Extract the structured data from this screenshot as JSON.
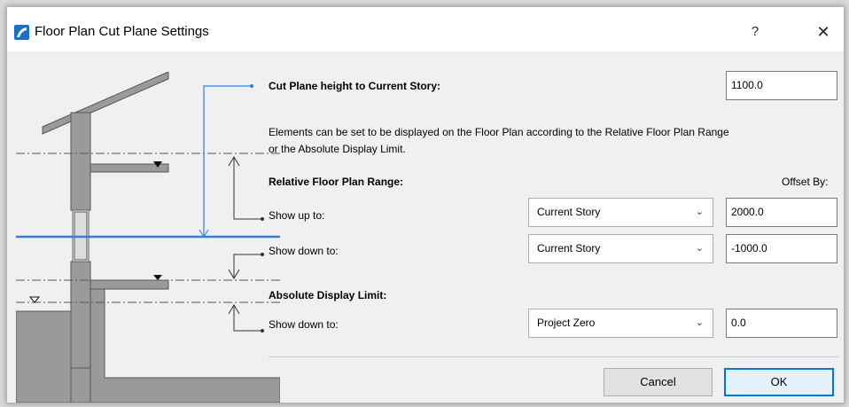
{
  "window": {
    "title": "Floor Plan Cut Plane Settings",
    "help_glyph": "?",
    "close_glyph": "✕"
  },
  "colors": {
    "cut_line": "#2f7fe0",
    "wall": "#9a9a9a",
    "ok_border": "#0078d7"
  },
  "cut_plane": {
    "label": "Cut Plane height to Current Story:",
    "value": "1100.0"
  },
  "description": {
    "line1": "Elements can be set to be displayed on the Floor Plan according to the Relative Floor Plan Range",
    "line2": "or the Absolute Display Limit."
  },
  "relative": {
    "heading": "Relative Floor Plan Range:",
    "offset_header": "Offset By:",
    "up": {
      "label": "Show up to:",
      "story": "Current Story",
      "offset": "2000.0"
    },
    "down": {
      "label": "Show down to:",
      "story": "Current Story",
      "offset": "-1000.0"
    }
  },
  "absolute": {
    "heading": "Absolute Display Limit:",
    "down": {
      "label": "Show down to:",
      "story": "Project Zero",
      "offset": "0.0"
    }
  },
  "buttons": {
    "cancel": "Cancel",
    "ok": "OK"
  },
  "icons": {
    "dropdown": "chevron-down-icon",
    "app": "archicad-icon"
  }
}
